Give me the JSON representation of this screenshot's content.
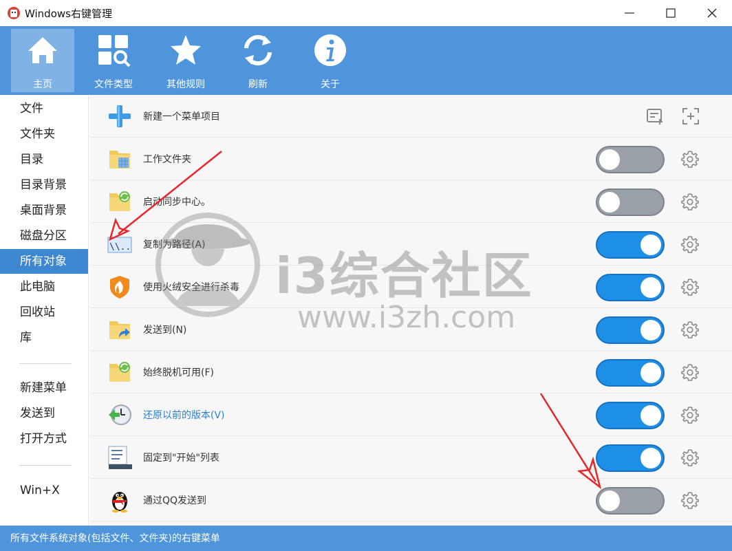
{
  "window": {
    "title": "Windows右键管理"
  },
  "toolbar": {
    "items": [
      {
        "label": "主页",
        "icon": "home-icon"
      },
      {
        "label": "文件类型",
        "icon": "file-types-icon"
      },
      {
        "label": "其他规则",
        "icon": "star-icon"
      },
      {
        "label": "刷新",
        "icon": "refresh-icon"
      },
      {
        "label": "关于",
        "icon": "info-icon"
      }
    ]
  },
  "sidebar": {
    "items": [
      "文件",
      "文件夹",
      "目录",
      "目录背景",
      "桌面背景",
      "磁盘分区",
      "所有对象",
      "此电脑",
      "回收站",
      "库",
      "新建菜单",
      "发送到",
      "打开方式",
      "Win+X"
    ],
    "selected": "所有对象"
  },
  "list": {
    "header": {
      "label": "新建一个菜单项目"
    },
    "rows": [
      {
        "label": "工作文件夹",
        "enabled": false,
        "icon": "work-folder-icon"
      },
      {
        "label": "启动同步中心。",
        "enabled": false,
        "icon": "sync-folder-icon"
      },
      {
        "label": "复制为路径(A)",
        "enabled": true,
        "icon": "copy-path-icon"
      },
      {
        "label": "使用火绒安全进行杀毒",
        "enabled": true,
        "icon": "huorong-shield-icon"
      },
      {
        "label": "发送到(N)",
        "enabled": true,
        "icon": "send-to-folder-icon"
      },
      {
        "label": "始终脱机可用(F)",
        "enabled": true,
        "icon": "offline-folder-icon"
      },
      {
        "label": "还原以前的版本(V)",
        "enabled": true,
        "icon": "restore-clock-icon"
      },
      {
        "label": "固定到\"开始\"列表",
        "enabled": true,
        "icon": "pin-start-icon"
      },
      {
        "label": "通过QQ发送到",
        "enabled": false,
        "icon": "qq-penguin-icon"
      }
    ]
  },
  "status": {
    "text": "所有文件系统对象(包括文件、文件夹)的右键菜单"
  },
  "watermark": {
    "title": "i3综合社区",
    "url": "www.i3zh.com"
  },
  "colors": {
    "toolbar": "#4f95dc",
    "toggle_on": "#1e8fe6",
    "toggle_off": "#9aa0a8",
    "sidebar_active": "#3d87d0"
  }
}
